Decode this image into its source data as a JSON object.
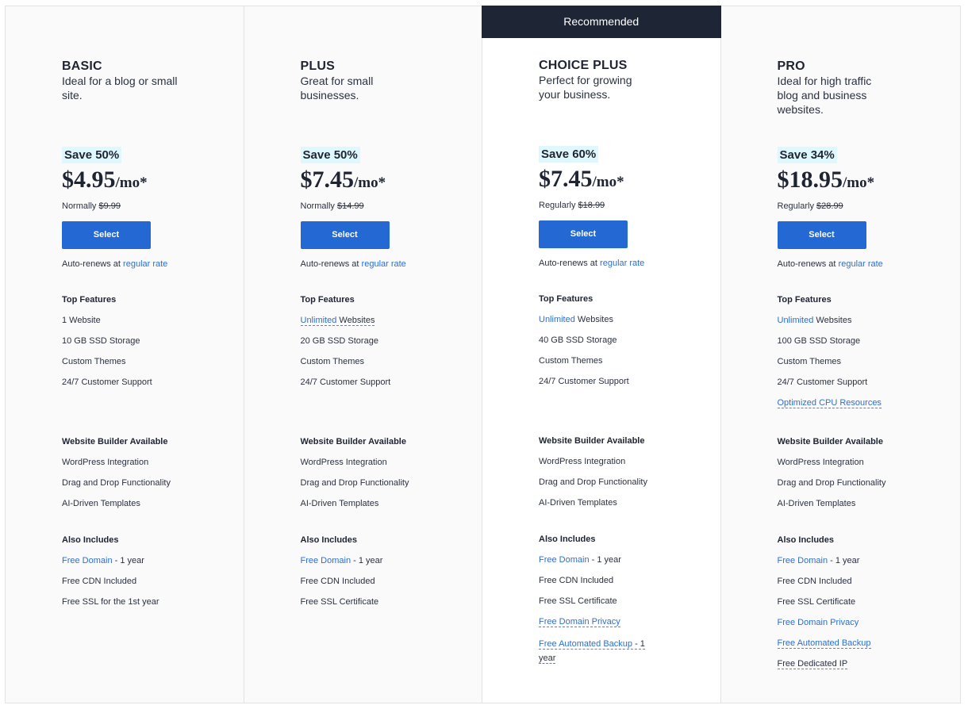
{
  "recommended_label": "Recommended",
  "select_label": "Select",
  "auto_renews_prefix": "Auto-renews at",
  "regular_rate_link": "regular rate",
  "sections": {
    "top_features": "Top Features",
    "website_builder": "Website Builder Available",
    "also_includes": "Also Includes"
  },
  "plans": [
    {
      "name": "BASIC",
      "description": "Ideal for a blog or small site.",
      "save": "Save 50%",
      "price": "$4.95",
      "per": "/mo*",
      "normal_label": "Normally",
      "normal_price": "$9.99",
      "top_features": [
        {
          "link": "",
          "text": "1 Website"
        },
        {
          "link": "",
          "text": "10 GB SSD Storage"
        },
        {
          "link": "",
          "text": "Custom Themes"
        },
        {
          "link": "",
          "text": "24/7 Customer Support"
        }
      ],
      "builder": [
        "WordPress Integration",
        "Drag and Drop Functionality",
        "AI-Driven Templates"
      ],
      "also": [
        {
          "link": "Free Domain",
          "text": " - 1 year"
        },
        {
          "link": "",
          "text": "Free CDN Included"
        },
        {
          "link": "",
          "text": "Free SSL for the 1st year"
        }
      ]
    },
    {
      "name": "PLUS",
      "description": "Great for small businesses.",
      "save": "Save 50%",
      "price": "$7.45",
      "per": "/mo*",
      "normal_label": "Normally",
      "normal_price": "$14.99",
      "top_features": [
        {
          "link": "Unlimited",
          "text": " Websites"
        },
        {
          "link": "",
          "text": "20 GB SSD Storage"
        },
        {
          "link": "",
          "text": "Custom Themes"
        },
        {
          "link": "",
          "text": "24/7 Customer Support"
        }
      ],
      "builder": [
        "WordPress Integration",
        "Drag and Drop Functionality",
        "AI-Driven Templates"
      ],
      "also": [
        {
          "link": "Free Domain",
          "text": " - 1 year"
        },
        {
          "link": "",
          "text": "Free CDN Included"
        },
        {
          "link": "",
          "text": "Free SSL Certificate"
        }
      ]
    },
    {
      "name": "CHOICE PLUS",
      "description": "Perfect for growing your business.",
      "save": "Save 60%",
      "price": "$7.45",
      "per": "/mo*",
      "normal_label": "Regularly",
      "normal_price": "$18.99",
      "top_features": [
        {
          "link": "Unlimited",
          "text": " Websites"
        },
        {
          "link": "",
          "text": "40 GB SSD Storage"
        },
        {
          "link": "",
          "text": "Custom Themes"
        },
        {
          "link": "",
          "text": "24/7 Customer Support"
        }
      ],
      "builder": [
        "WordPress Integration",
        "Drag and Drop Functionality",
        "AI-Driven Templates"
      ],
      "also": [
        {
          "link": "Free Domain",
          "text": " - 1 year"
        },
        {
          "link": "",
          "text": "Free CDN Included"
        },
        {
          "link": "",
          "text": "Free SSL Certificate"
        },
        {
          "link": "Free Domain Privacy",
          "text": ""
        },
        {
          "link": "Free Automated Backup",
          "text": " - 1 year"
        }
      ]
    },
    {
      "name": "PRO",
      "description": "Ideal for high traffic blog and business websites.",
      "save": "Save 34%",
      "price": "$18.95",
      "per": "/mo*",
      "normal_label": "Regularly",
      "normal_price": "$28.99",
      "top_features": [
        {
          "link": "Unlimited",
          "text": " Websites"
        },
        {
          "link": "",
          "text": "100 GB SSD Storage"
        },
        {
          "link": "",
          "text": "Custom Themes"
        },
        {
          "link": "",
          "text": "24/7 Customer Support"
        },
        {
          "link": "Optimized CPU Resources",
          "text": ""
        }
      ],
      "builder": [
        "WordPress Integration",
        "Drag and Drop Functionality",
        "AI-Driven Templates"
      ],
      "also": [
        {
          "link": "Free Domain",
          "text": " - 1 year"
        },
        {
          "link": "",
          "text": "Free CDN Included"
        },
        {
          "link": "",
          "text": "Free SSL Certificate"
        },
        {
          "link": "Free Domain Privacy",
          "text": ""
        },
        {
          "link": "Free Automated Backup",
          "text": ""
        },
        {
          "link": "",
          "text": "Free Dedicated IP"
        }
      ]
    }
  ]
}
